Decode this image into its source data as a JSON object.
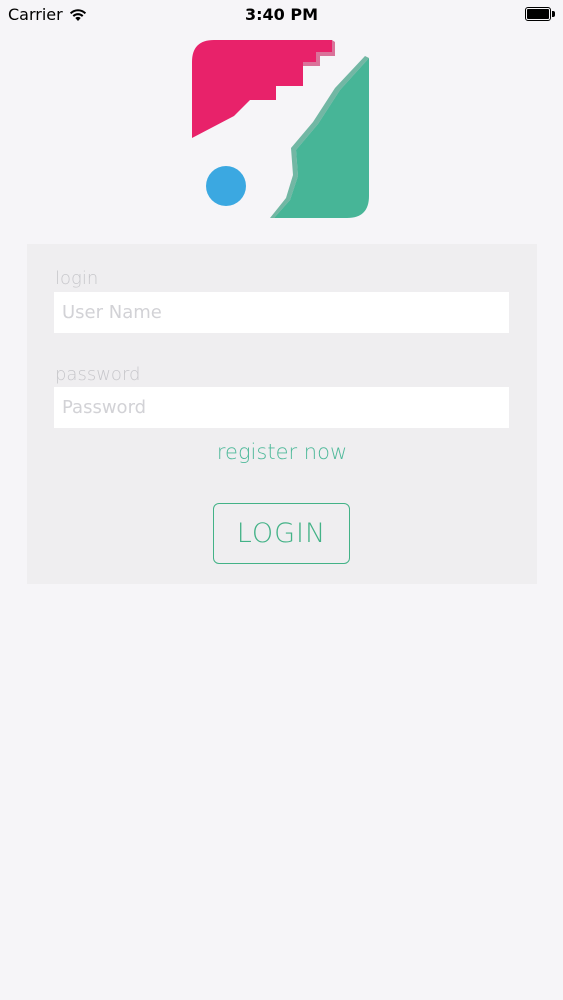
{
  "status_bar": {
    "carrier": "Carrier",
    "time": "3:40 PM",
    "battery_level": 1.0
  },
  "logo": {
    "icon": "key-lock-logo",
    "colors": {
      "pink": "#e8226a",
      "green": "#47b597",
      "blue": "#3ba8e1"
    }
  },
  "form": {
    "login_label": "login",
    "username_placeholder": "User Name",
    "username_value": "",
    "password_label": "password",
    "password_placeholder": "Password",
    "password_value": "",
    "register_link": "register now",
    "login_button": "LOGIN"
  },
  "colors": {
    "accent": "#43b287",
    "background": "#f6f5f8",
    "card": "#efeef0"
  }
}
